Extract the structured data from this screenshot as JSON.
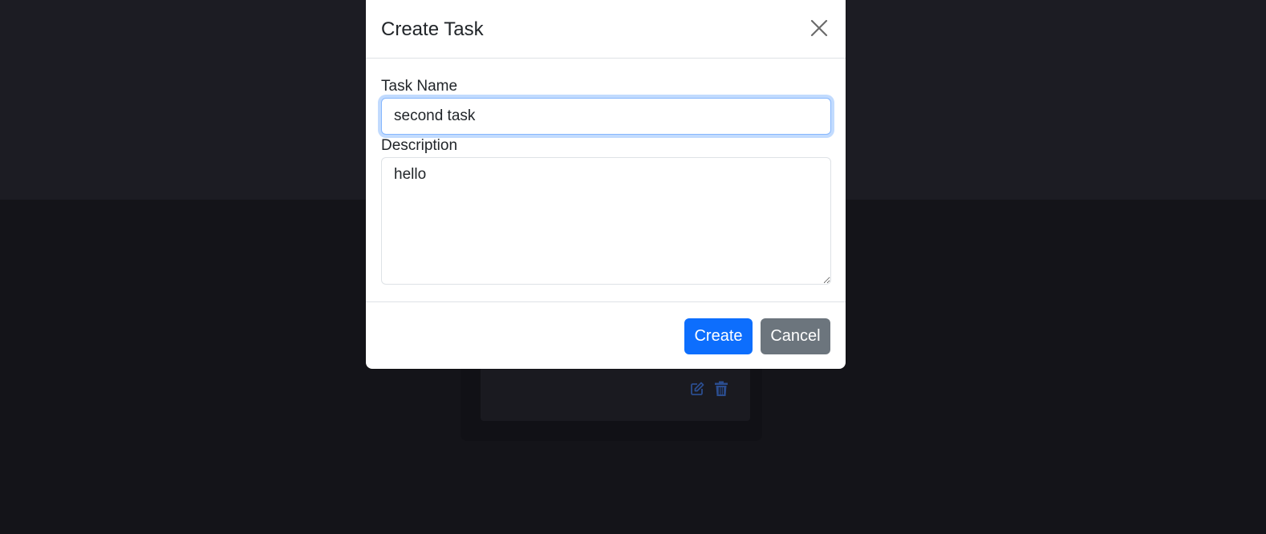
{
  "modal": {
    "title": "Create Task",
    "close_icon": "close-icon",
    "task_name": {
      "label": "Task Name",
      "value": "second task"
    },
    "description": {
      "label": "Description",
      "value": "hello"
    },
    "buttons": {
      "create": "Create",
      "cancel": "Cancel"
    }
  },
  "background": {
    "card_icons": [
      "edit-icon",
      "trash-icon"
    ]
  },
  "colors": {
    "primary": "#0d6efd",
    "secondary": "#6c757d",
    "backdrop": "#141419",
    "focus_border": "#86b7fe"
  }
}
